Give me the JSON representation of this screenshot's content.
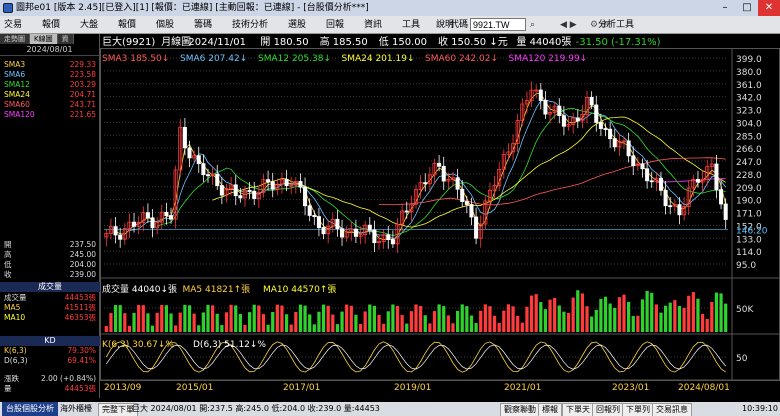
{
  "window": {
    "title": "圖邦e01 [版本 2.45][已登入][1] [報價：已連線] [主動回報：已連線] - [台股價分析***]"
  },
  "menu": {
    "items": [
      "交易",
      "報價",
      "大盤",
      "報價",
      "個股",
      "籌碼",
      "技術分析",
      "選股",
      "回報",
      "資訊",
      "工具",
      "說明"
    ],
    "code_label": "代碼",
    "code_value": "9921.TW",
    "analysis_tool": "分析工具"
  },
  "sidebar": {
    "tabs": [
      "走勢圖",
      "K線圖",
      "資"
    ],
    "date": "2024/08/01",
    "sma_rows": [
      {
        "k": "SMA3",
        "v": "229.33",
        "color": "#ffd23f"
      },
      {
        "k": "SMA6",
        "v": "223.58",
        "color": "#6ec3ff"
      },
      {
        "k": "SMA12",
        "v": "203.29",
        "color": "#33dd33"
      },
      {
        "k": "SMA24",
        "v": "204.71",
        "color": "#ffff33"
      },
      {
        "k": "SMA60",
        "v": "243.71",
        "color": "#ff5a5a"
      },
      {
        "k": "SMA120",
        "v": "221.65",
        "color": "#ff3dff"
      }
    ],
    "ohlc_rows": [
      {
        "k": "開",
        "v": "237.50"
      },
      {
        "k": "高",
        "v": "245.00"
      },
      {
        "k": "低",
        "v": "204.00"
      },
      {
        "k": "收",
        "v": "239.00"
      }
    ],
    "vol_head": "成交量",
    "vol_rows": [
      {
        "k": "成交量",
        "v": "44453張"
      },
      {
        "k": "MA5",
        "v": "41511張"
      },
      {
        "k": "MA10",
        "v": "46353張"
      }
    ],
    "kd_head": "KD",
    "kd_rows": [
      {
        "k": "K(6,3)",
        "v": "79.30%"
      },
      {
        "k": "D(6,3)",
        "v": "69.41%"
      }
    ],
    "chg_rows": [
      {
        "k": "漲跌",
        "v": "2.00 (+0.84%)"
      },
      {
        "k": "量",
        "v": "44453張"
      }
    ]
  },
  "chart_data": {
    "type": "candlestick",
    "header": {
      "name": "巨大(9921)",
      "period": "月線圖",
      "date": "2024/11/01",
      "open_label": "開",
      "open": "180.50",
      "high_label": "高",
      "high": "185.50",
      "low_label": "低",
      "low": "150.00",
      "close_label": "收",
      "close": "150.50",
      "unit": "元",
      "vol_label": "量",
      "vol": "44040",
      "vol_unit": "張",
      "change": "-31.50 (-17.31%)"
    },
    "legend": [
      {
        "name": "SMA3 185.50",
        "arrow": "↓",
        "color": "#ff5a5a"
      },
      {
        "name": "SMA6 207.42",
        "arrow": "↓",
        "color": "#6ec3ff"
      },
      {
        "name": "SMA12 205.38",
        "arrow": "↓",
        "color": "#33dd33"
      },
      {
        "name": "SMA24 201.19",
        "arrow": "↓",
        "color": "#ffff33"
      },
      {
        "name": "SMA60 242.02",
        "arrow": "↓",
        "color": "#ff5a5a"
      },
      {
        "name": "SMA120 219.99",
        "arrow": "↓",
        "color": "#ff3dff"
      }
    ],
    "price_ticks": [
      "399.0",
      "380.0",
      "361.0",
      "342.0",
      "323.0",
      "304.0",
      "285.0",
      "266.0",
      "247.0",
      "228.0",
      "209.0",
      "190.0",
      "171.0",
      "152.0",
      "133.0",
      "114.0",
      "95.0"
    ],
    "price_range": [
      95,
      399
    ],
    "last_price": "146.20",
    "volume_legend": [
      {
        "name": "成交量 44040",
        "arrow": "↓張",
        "color": "#ffffff"
      },
      {
        "name": "MA5 41821",
        "arrow": "↑張",
        "color": "#ffd23f"
      },
      {
        "name": "MA10 44570",
        "arrow": "↑張",
        "color": "#ffff33"
      }
    ],
    "volume_tick": "50K",
    "kd_legend": [
      {
        "name": "K(6,3) 30.67",
        "arrow": "↓%",
        "color": "#ffd23f"
      },
      {
        "name": "D(6,3) 51.12",
        "arrow": "↓%",
        "color": "#ffffff"
      }
    ],
    "kd_tick": "50",
    "x_labels": [
      "2013/09",
      "2015/01",
      "2017/01",
      "2019/01",
      "2021/01",
      "2023/01",
      "2024/08/01"
    ],
    "x_range_months": [
      "2013/09",
      "2024/11"
    ]
  },
  "statusbar": {
    "tabs": [
      "台股個股分析",
      "海外櫃檯"
    ],
    "mid": "完整下單",
    "info": "巨大 2024/08/01 開:237.5 高:245.0 低:204.0 收:239.0 量:44453",
    "buttons": [
      "觀察聯動",
      "標報",
      "下單天",
      "回報列",
      "下單列",
      "交易訊息"
    ],
    "time": "10:39:10"
  },
  "colors": {
    "up": "#ff3b3b",
    "down": "#ffffff",
    "grid": "#3a3a3a",
    "axis": "#888888"
  }
}
